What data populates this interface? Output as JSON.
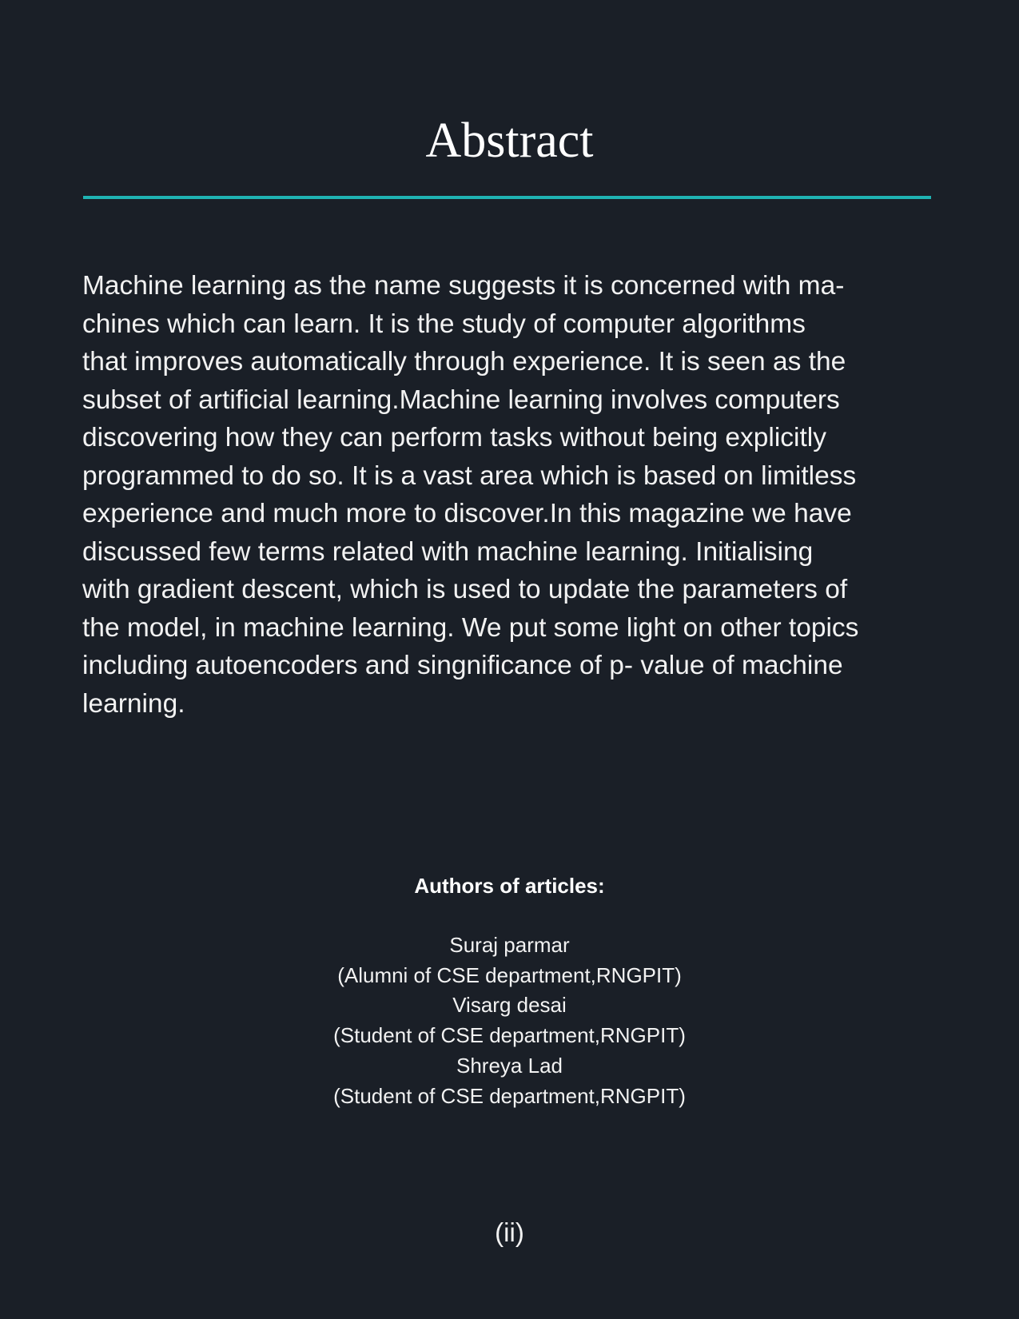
{
  "page": {
    "title": "Abstract",
    "abstract_lines": [
      "Machine learning as the name suggests it is concerned with ma-",
      "chines which can learn. It is the study of computer algorithms",
      "that improves automatically through experience. It is seen as the",
      "subset of artificial learning.Machine learning involves computers",
      "discovering how they can perform tasks without being explicitly",
      "programmed to do so. It is a vast area which is based on limitless",
      "experience and much more to discover.In this magazine we have",
      "discussed few terms related with machine learning. Initialising",
      "with gradient descent, which is used to update the parameters of",
      "the model, in machine learning. We put some light on other topics",
      "including autoencoders and singnificance of p- value of machine",
      "learning."
    ],
    "authors_heading": "Authors of articles:",
    "authors": [
      {
        "name": "Suraj parmar",
        "affiliation": "(Alumni of CSE department,RNGPIT)"
      },
      {
        "name": "Visarg desai",
        "affiliation": "(Student of CSE department,RNGPIT)"
      },
      {
        "name": "Shreya Lad",
        "affiliation": "(Student of CSE department,RNGPIT)"
      }
    ],
    "page_number": "(ii)"
  },
  "colors": {
    "background": "#1a1f27",
    "text": "#f2f2f2",
    "accent_rule": "#1fb3b3"
  }
}
